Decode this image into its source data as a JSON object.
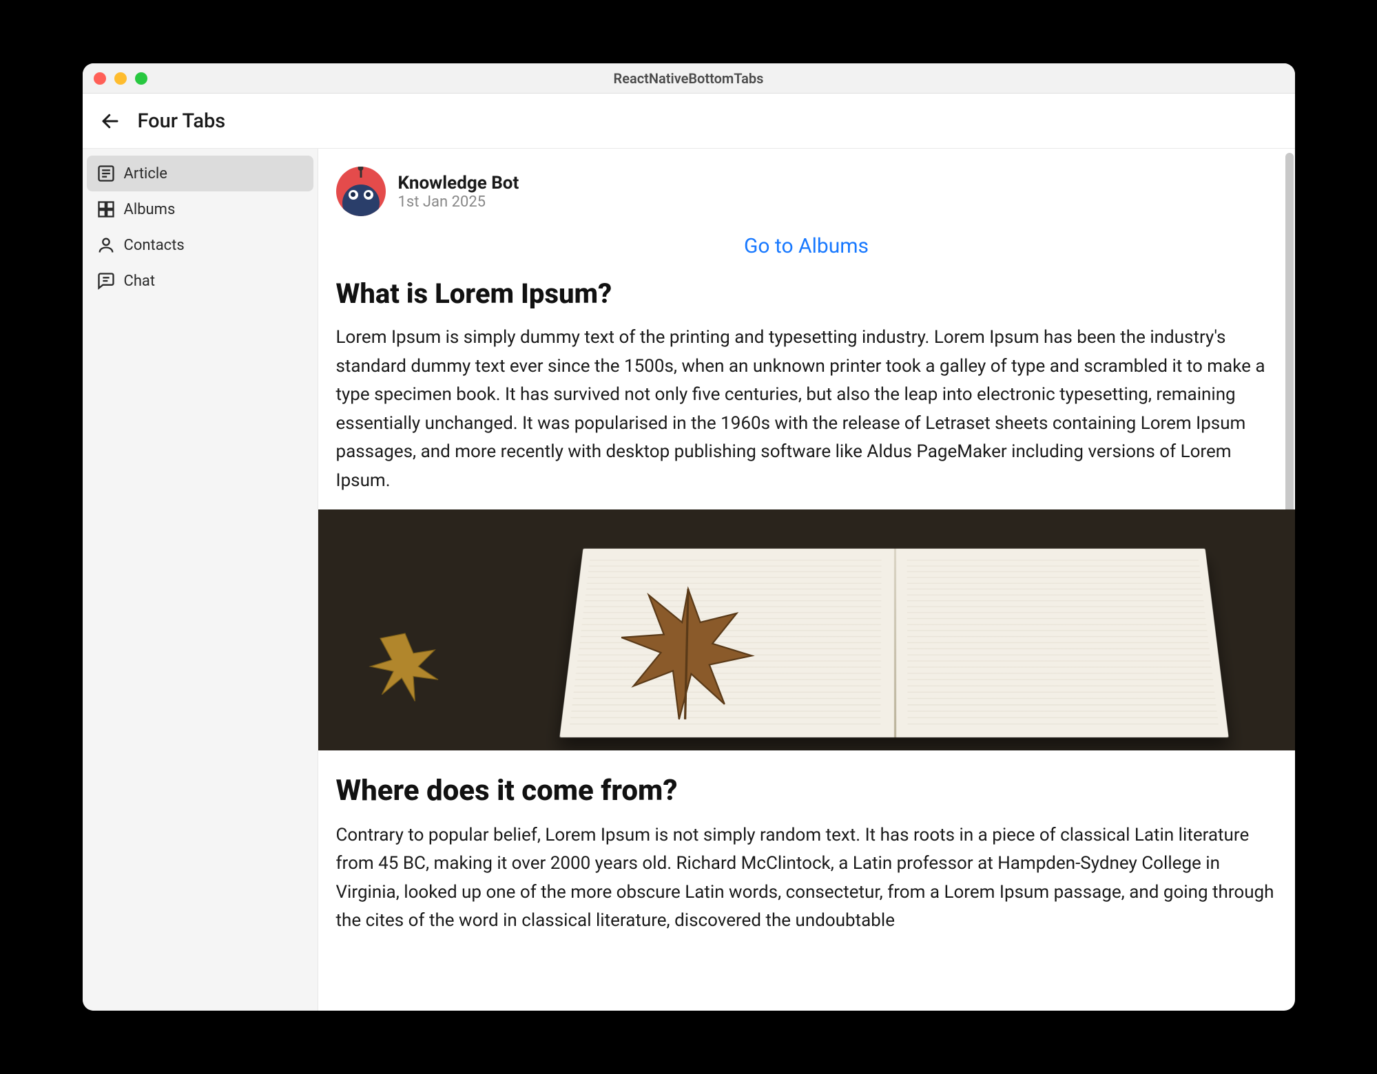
{
  "window": {
    "title": "ReactNativeBottomTabs"
  },
  "header": {
    "title": "Four Tabs"
  },
  "sidebar": {
    "items": [
      {
        "label": "Article",
        "active": true
      },
      {
        "label": "Albums",
        "active": false
      },
      {
        "label": "Contacts",
        "active": false
      },
      {
        "label": "Chat",
        "active": false
      }
    ]
  },
  "article": {
    "author": {
      "name": "Knowledge Bot",
      "date": "1st Jan 2025"
    },
    "link": {
      "label": "Go to Albums"
    },
    "sections": [
      {
        "heading": "What is Lorem Ipsum?",
        "body": "Lorem Ipsum is simply dummy text of the printing and typesetting industry. Lorem Ipsum has been the industry's standard dummy text ever since the 1500s, when an unknown printer took a galley of type and scrambled it to make a type specimen book. It has survived not only five centuries, but also the leap into electronic typesetting, remaining essentially unchanged. It was popularised in the 1960s with the release of Letraset sheets containing Lorem Ipsum passages, and more recently with desktop publishing software like Aldus PageMaker including versions of Lorem Ipsum."
      },
      {
        "heading": "Where does it come from?",
        "body": "Contrary to popular belief, Lorem Ipsum is not simply random text. It has roots in a piece of classical Latin literature from 45 BC, making it over 2000 years old. Richard McClintock, a Latin professor at Hampden-Sydney College in Virginia, looked up one of the more obscure Latin words, consectetur, from a Lorem Ipsum passage, and going through the cites of the word in classical literature, discovered the undoubtable"
      }
    ]
  }
}
